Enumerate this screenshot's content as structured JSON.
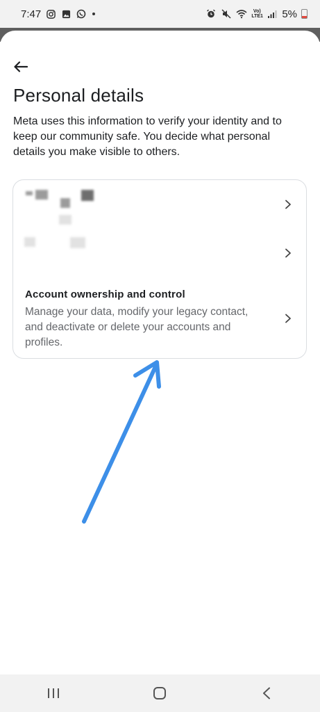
{
  "status_bar": {
    "time": "7:47",
    "battery": "5%",
    "network": "Vo) LTE1",
    "icons": [
      "instagram-icon",
      "gallery-icon",
      "whatsapp-icon",
      "alarm-icon",
      "mute-icon",
      "wifi-icon",
      "signal-icon",
      "battery-icon"
    ]
  },
  "header": {
    "back_icon": "arrow-left-icon",
    "title": "Personal details"
  },
  "description": "Meta uses this information to verify your identity and to keep our community safe. You decide what personal details you make visible to others.",
  "card": {
    "rows": [
      {
        "label": "",
        "redacted": true,
        "chevron": "chevron-right-icon"
      },
      {
        "label": "",
        "redacted": true,
        "chevron": "chevron-right-icon"
      },
      {
        "title": "Account ownership and control",
        "description": "Manage your data, modify your legacy contact, and deactivate or delete your accounts and profiles.",
        "chevron": "chevron-right-icon"
      }
    ]
  },
  "annotation": {
    "color": "#3d8fe8",
    "icon": "arrow-annotation-icon"
  },
  "nav_bar": {
    "buttons": [
      "recent-apps-icon",
      "home-icon",
      "back-icon"
    ]
  }
}
